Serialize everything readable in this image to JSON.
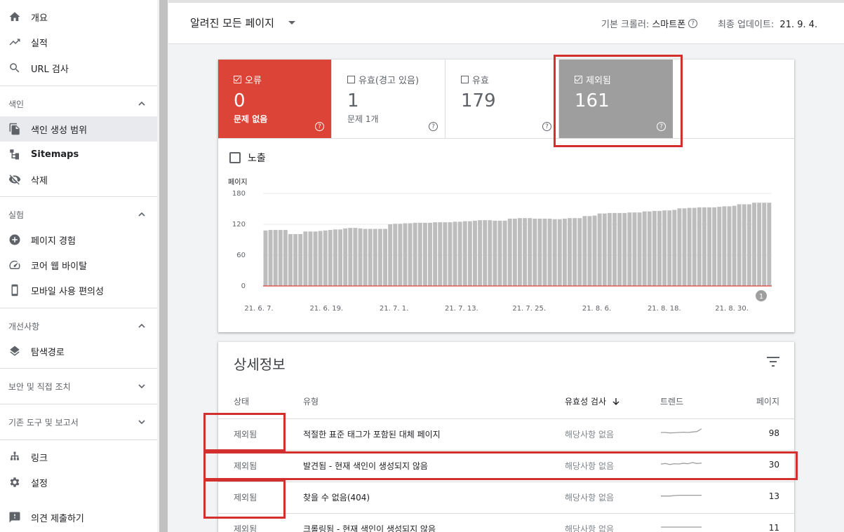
{
  "sidebar": {
    "top_items": [
      {
        "label": "개요",
        "icon": "home-icon"
      },
      {
        "label": "실적",
        "icon": "trending-up-icon"
      },
      {
        "label": "URL 검사",
        "icon": "search-icon"
      }
    ],
    "sections": [
      {
        "title": "색인",
        "expanded": true,
        "items": [
          {
            "label": "색인 생성 범위",
            "icon": "file-copy-icon",
            "active": true
          },
          {
            "label": "Sitemaps",
            "icon": "sitemap-icon"
          },
          {
            "label": "삭제",
            "icon": "eye-off-icon"
          }
        ]
      },
      {
        "title": "실험",
        "expanded": true,
        "items": [
          {
            "label": "페이지 경험",
            "icon": "add-circle-icon"
          },
          {
            "label": "코어 웹 바이탈",
            "icon": "speed-icon"
          },
          {
            "label": "모바일 사용 편의성",
            "icon": "smartphone-icon"
          }
        ]
      },
      {
        "title": "개선사항",
        "expanded": true,
        "items": [
          {
            "label": "탐색경로",
            "icon": "layers-icon"
          }
        ]
      },
      {
        "title": "보안 및 직접 조치",
        "expanded": false,
        "items": []
      },
      {
        "title": "기존 도구 및 보고서",
        "expanded": false,
        "items": []
      }
    ],
    "bottom_items": [
      {
        "label": "링크",
        "icon": "links-icon"
      },
      {
        "label": "설정",
        "icon": "settings-icon"
      }
    ],
    "feedback": {
      "label": "의견 제출하기",
      "icon": "feedback-icon"
    }
  },
  "topbar": {
    "page_filter": "알려진 모든 페이지",
    "crawler_label": "기본 크롤러:",
    "crawler_value": "스마트폰",
    "updated_label": "최종 업데이트:",
    "updated_value": "21. 9. 4."
  },
  "summary": {
    "tiles": [
      {
        "id": "error",
        "label": "오류",
        "value": "0",
        "sub": "문제 없음",
        "checked": true,
        "color": "#db4437"
      },
      {
        "id": "warn",
        "label": "유효(경고 있음)",
        "value": "1",
        "sub": "문제 1개",
        "checked": false
      },
      {
        "id": "valid",
        "label": "유효",
        "value": "179",
        "sub": "",
        "checked": false
      },
      {
        "id": "excluded",
        "label": "제외됨",
        "value": "161",
        "sub": "",
        "checked": true,
        "color": "#9e9e9e"
      }
    ],
    "impressions_label": "노출",
    "help_glyph": "?"
  },
  "chart_data": {
    "type": "bar",
    "ylabel": "페이지",
    "ylim": [
      0,
      180
    ],
    "yticks": [
      0,
      60,
      120,
      180
    ],
    "xtick_labels": [
      "21. 6. 7.",
      "21. 6. 19.",
      "21. 7. 1.",
      "21. 7. 13.",
      "21. 7. 25.",
      "21. 8. 6.",
      "21. 8. 18.",
      "21. 8. 30."
    ],
    "series": [
      {
        "values": [
          108,
          109,
          109,
          109,
          109,
          101,
          101,
          101,
          106,
          106,
          106,
          107,
          108,
          109,
          110,
          110,
          112,
          113,
          113,
          112,
          111,
          111,
          111,
          111,
          111,
          120,
          121,
          121,
          122,
          122,
          123,
          123,
          123,
          123,
          124,
          124,
          124,
          124,
          125,
          125,
          126,
          126,
          127,
          128,
          128,
          128,
          127,
          127,
          127,
          131,
          131,
          132,
          132,
          132,
          131,
          131,
          131,
          131,
          130,
          130,
          131,
          132,
          132,
          132,
          136,
          136,
          137,
          141,
          141,
          142,
          142,
          142,
          142,
          143,
          143,
          143,
          145,
          145,
          146,
          146,
          147,
          147,
          148,
          151,
          151,
          152,
          152,
          153,
          153,
          153,
          153,
          154,
          155,
          155,
          156,
          159,
          159,
          159,
          162,
          162,
          162,
          162
        ]
      },
      {
        "values": [
          0,
          0,
          0,
          0,
          0,
          0,
          0,
          0,
          0,
          0,
          0,
          0,
          0,
          0,
          0,
          0,
          0,
          0,
          0,
          0,
          0,
          0,
          0,
          0,
          0,
          0,
          0,
          0,
          0,
          0,
          0,
          0,
          0,
          0,
          0,
          0,
          0,
          0,
          0,
          0,
          0,
          0,
          0,
          0,
          0,
          0,
          0,
          0,
          0,
          0,
          0,
          0,
          0,
          0,
          0,
          0,
          0,
          0,
          0,
          0,
          0,
          0,
          0,
          0,
          0,
          0,
          0,
          0,
          0,
          0,
          0,
          0,
          0,
          0,
          0,
          0,
          0,
          0,
          0,
          0,
          0,
          0,
          0,
          0,
          0,
          0,
          0,
          0,
          0,
          0,
          0,
          0,
          0,
          0,
          0,
          0,
          0,
          0,
          0,
          0,
          0,
          0
        ],
        "color": "#db4437"
      }
    ],
    "annotation": "1",
    "bar_color": "#bdbdbd"
  },
  "details": {
    "title": "상세정보",
    "columns": [
      "상태",
      "유형",
      "유효성 검사",
      "트렌드",
      "페이지"
    ],
    "rows": [
      {
        "status": "제외됨",
        "type": "적절한 표준 태그가 포함된 대체 페이지",
        "validation": "해당사항 없음",
        "pages": "98",
        "trend": [
          2,
          2,
          1.8,
          1.9,
          2,
          2.1,
          2,
          2.2,
          2.4,
          3.5
        ]
      },
      {
        "status": "제외됨",
        "type": "발견됨 - 현재 색인이 생성되지 않음",
        "validation": "해당사항 없음",
        "pages": "30",
        "trend": [
          2,
          2.2,
          1.8,
          2.1,
          2,
          2.3,
          2.1,
          2.6,
          2.2,
          2.4
        ]
      },
      {
        "status": "제외됨",
        "type": "찾을 수 없음(404)",
        "validation": "해당사항 없음",
        "pages": "13",
        "trend": [
          1.8,
          1.8,
          1.8,
          2,
          2.1,
          2.1,
          2.1,
          2.1,
          2.1,
          2.1
        ]
      },
      {
        "status": "제외됨",
        "type": "크롤링됨 - 현재 색인이 생성되지 않음",
        "validation": "해당사항 없음",
        "pages": "11",
        "trend": [
          2,
          2,
          2,
          2,
          2,
          2,
          2,
          2,
          2,
          2
        ]
      }
    ]
  }
}
